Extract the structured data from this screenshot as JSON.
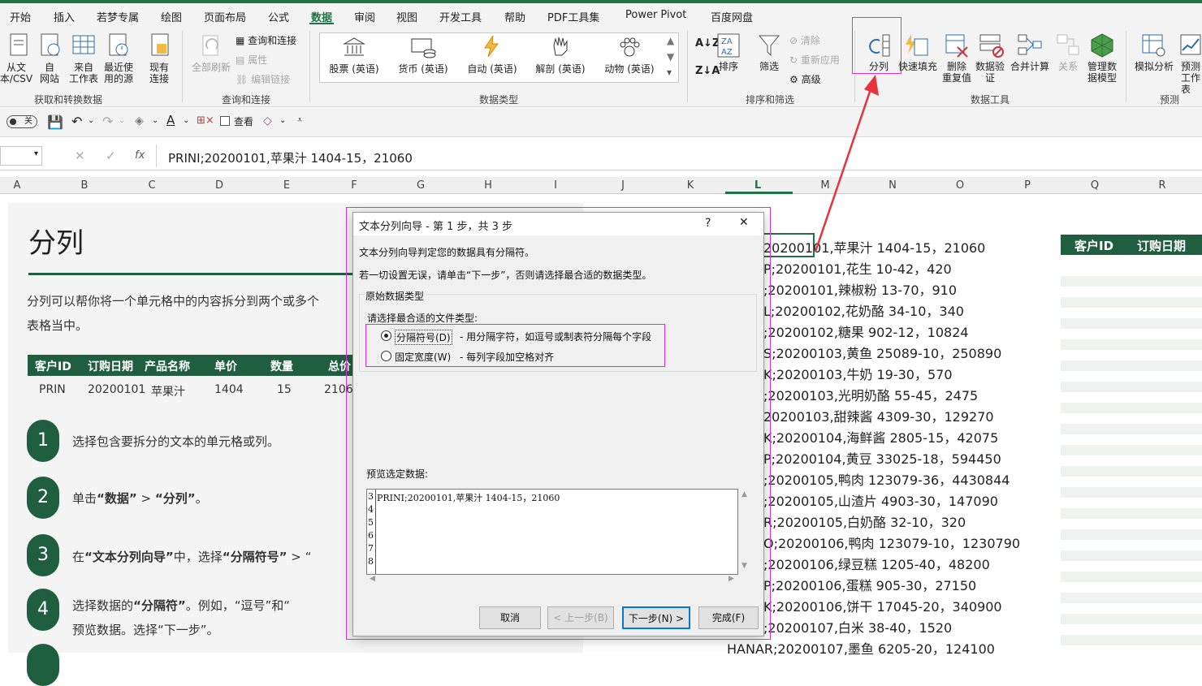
{
  "menu": {
    "tabs": [
      "开始",
      "插入",
      "若梦专属",
      "绘图",
      "页面布局",
      "公式",
      "数据",
      "审阅",
      "视图",
      "开发工具",
      "帮助",
      "PDF工具集",
      "Power Pivot",
      "百度网盘"
    ],
    "active": "数据"
  },
  "ribbon": {
    "get_data": {
      "from_text": "从文\n本/CSV",
      "from_web": "自\n网站",
      "from_table": "来自\n工作表",
      "recent": "最近使\n用的源",
      "existing": "现有\n连接",
      "group": "获取和转换数据"
    },
    "queries": {
      "refresh_all": "全部刷新",
      "queries_connections": "查询和连接",
      "properties": "属性",
      "edit_links": "编辑链接",
      "group": "查询和连接"
    },
    "data_types": {
      "stocks": "股票 (英语)",
      "currency": "货币 (英语)",
      "auto": "自动 (英语)",
      "anatomy": "解剖 (英语)",
      "animals": "动物 (英语)",
      "group": "数据类型"
    },
    "sort_filter": {
      "sort": "排序",
      "filter": "筛选",
      "clear": "清除",
      "reapply": "重新应用",
      "advanced": "高级",
      "group": "排序和筛选"
    },
    "data_tools": {
      "text_to_columns": "分列",
      "flash_fill": "快速填充",
      "remove_dup": "删除\n重复值",
      "validation": "数据验\n证",
      "consolidate": "合并计算",
      "relationships": "关系",
      "data_model": "管理数\n据模型",
      "group": "数据工具"
    },
    "forecast": {
      "what_if": "模拟分析",
      "forecast_sheet": "预测\n工作表",
      "group": "预测"
    }
  },
  "qat": {
    "toggle": "关",
    "view": "查看"
  },
  "formula_bar": {
    "fx": "fx",
    "content": "PRINI;20200101,苹果汁 1404-15，21060"
  },
  "columns": [
    "A",
    "B",
    "C",
    "D",
    "E",
    "F",
    "G",
    "H",
    "I",
    "J",
    "K",
    "L",
    "M",
    "N",
    "O",
    "P",
    "Q",
    "R"
  ],
  "panel": {
    "title": "分列",
    "intro_1": "分列可以帮你将一个单元格中的内容拆分到两个或多个",
    "intro_2": "表格当中。",
    "table_headers": [
      "客户ID",
      "订购日期",
      "产品名称",
      "单价",
      "数量",
      "总价"
    ],
    "table_row": [
      "PRIN",
      "20200101",
      "苹果汁",
      "1404",
      "15",
      "2106"
    ],
    "steps": [
      {
        "num": "1",
        "text": "选择包含要拆分的文本的单元格或列。"
      },
      {
        "num": "2",
        "pre": "单击",
        "b1": "“数据”",
        "mid": " > ",
        "b2": "“分列”",
        "post": "。"
      },
      {
        "num": "3",
        "pre": "在",
        "b1": "“文本分列向导”",
        "mid": "中，选择",
        "b2": "“分隔符号”",
        "post": " > “"
      },
      {
        "num": "4",
        "pre": "选择数据的",
        "b1": "“分隔符”",
        "post": "。例如，“逗号”和“",
        "line2": "预览数据。选择“下一步”。"
      }
    ]
  },
  "sheet_lines": [
    "20200101,苹果汁 1404-15，21060",
    "P;20200101,花生 10-42，420",
    ";20200101,辣椒粉 13-70，910",
    "L;20200102,花奶酪 34-10，340",
    ";20200102,糖果 902-12，10824",
    "S;20200103,黄鱼 25089-10，250890",
    "K;20200103,牛奶 19-30，570",
    ";20200103,光明奶酪 55-45，2475",
    "20200103,甜辣酱 4309-30，129270",
    "K;20200104,海鲜酱 2805-15，42075",
    "P;20200104,黄豆 33025-18，594450",
    ";20200105,鸭肉 123079-36，4430844",
    ";20200105,山渣片 4903-30，147090",
    "R;20200105,白奶酪 32-10，320",
    "O;20200106,鸭肉 123079-10，1230790",
    ";20200106,绿豆糕 1205-40，48200",
    "P;20200106,蛋糕 905-30，27150",
    "K;20200106,饼干 17045-20，340900",
    ";20200107,白米 38-40，1520",
    "HANAR;20200107,墨鱼 6205-20，124100"
  ],
  "right_table": {
    "customer_id": "客户ID",
    "order_date": "订购日期"
  },
  "dialog": {
    "title": "文本分列向导 - 第 1 步，共 3 步",
    "help": "?",
    "close": "✕",
    "line1": "文本分列向导判定您的数据具有分隔符。",
    "line2": "若一切设置无误，请单击“下一步”，否则请选择最合适的数据类型。",
    "group_title": "原始数据类型",
    "choose_label": "请选择最合适的文件类型:",
    "option_delimited": "分隔符号(D)",
    "option_delimited_desc": "- 用分隔字符，如逗号或制表符分隔每个字段",
    "option_fixed": "固定宽度(W)",
    "option_fixed_desc": "- 每列字段加空格对齐",
    "preview_label": "预览选定数据:",
    "preview_rows": [
      "3",
      "4",
      "5",
      "6",
      "7",
      "8"
    ],
    "preview_line": "PRINI;20200101,苹果汁 1404-15，21060",
    "buttons": {
      "cancel": "取消",
      "back": "< 上一步(B)",
      "next": "下一步(N) >",
      "finish": "完成(F)"
    }
  },
  "colors": {
    "accent": "#217346",
    "panel_green": "#1f5f3f",
    "highlight": "#d633d6",
    "arrow": "#e8323c"
  }
}
